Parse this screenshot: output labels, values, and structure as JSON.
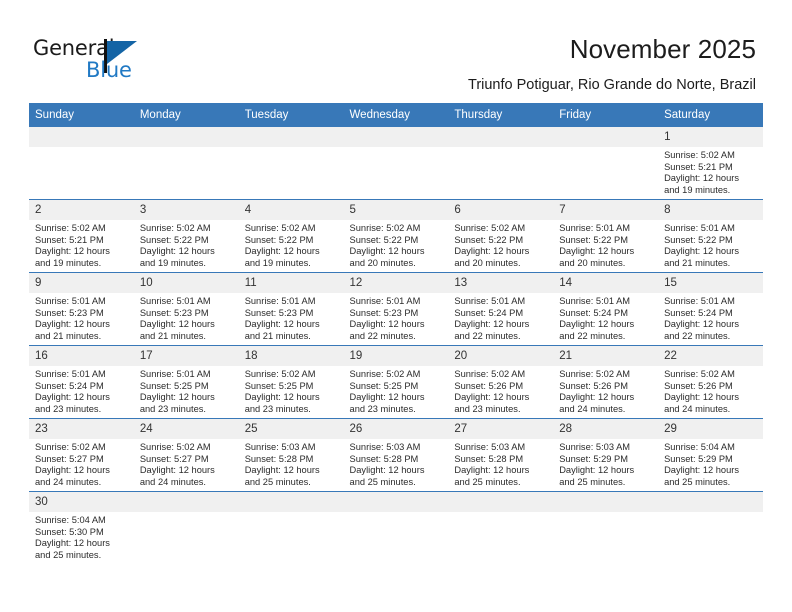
{
  "brand": {
    "name_part1": "General",
    "name_part2": "Blue",
    "flag_icon": "triangle-flag-icon",
    "colors": {
      "brand_blue": "#2079c4",
      "flag_blue": "#1464a5",
      "header_blue": "#3878b8",
      "date_band_gray": "#f0f0f0"
    }
  },
  "header": {
    "title": "November 2025",
    "subtitle": "Triunfo Potiguar, Rio Grande do Norte, Brazil"
  },
  "calendar": {
    "weekday_headers": [
      "Sunday",
      "Monday",
      "Tuesday",
      "Wednesday",
      "Thursday",
      "Friday",
      "Saturday"
    ],
    "weeks": [
      [
        {
          "day": "",
          "blank": true
        },
        {
          "day": "",
          "blank": true
        },
        {
          "day": "",
          "blank": true
        },
        {
          "day": "",
          "blank": true
        },
        {
          "day": "",
          "blank": true
        },
        {
          "day": "",
          "blank": true
        },
        {
          "day": "1",
          "sunrise": "Sunrise: 5:02 AM",
          "sunset": "Sunset: 5:21 PM",
          "daylight_line1": "Daylight: 12 hours",
          "daylight_line2": "and 19 minutes."
        }
      ],
      [
        {
          "day": "2",
          "sunrise": "Sunrise: 5:02 AM",
          "sunset": "Sunset: 5:21 PM",
          "daylight_line1": "Daylight: 12 hours",
          "daylight_line2": "and 19 minutes."
        },
        {
          "day": "3",
          "sunrise": "Sunrise: 5:02 AM",
          "sunset": "Sunset: 5:22 PM",
          "daylight_line1": "Daylight: 12 hours",
          "daylight_line2": "and 19 minutes."
        },
        {
          "day": "4",
          "sunrise": "Sunrise: 5:02 AM",
          "sunset": "Sunset: 5:22 PM",
          "daylight_line1": "Daylight: 12 hours",
          "daylight_line2": "and 19 minutes."
        },
        {
          "day": "5",
          "sunrise": "Sunrise: 5:02 AM",
          "sunset": "Sunset: 5:22 PM",
          "daylight_line1": "Daylight: 12 hours",
          "daylight_line2": "and 20 minutes."
        },
        {
          "day": "6",
          "sunrise": "Sunrise: 5:02 AM",
          "sunset": "Sunset: 5:22 PM",
          "daylight_line1": "Daylight: 12 hours",
          "daylight_line2": "and 20 minutes."
        },
        {
          "day": "7",
          "sunrise": "Sunrise: 5:01 AM",
          "sunset": "Sunset: 5:22 PM",
          "daylight_line1": "Daylight: 12 hours",
          "daylight_line2": "and 20 minutes."
        },
        {
          "day": "8",
          "sunrise": "Sunrise: 5:01 AM",
          "sunset": "Sunset: 5:22 PM",
          "daylight_line1": "Daylight: 12 hours",
          "daylight_line2": "and 21 minutes."
        }
      ],
      [
        {
          "day": "9",
          "sunrise": "Sunrise: 5:01 AM",
          "sunset": "Sunset: 5:23 PM",
          "daylight_line1": "Daylight: 12 hours",
          "daylight_line2": "and 21 minutes."
        },
        {
          "day": "10",
          "sunrise": "Sunrise: 5:01 AM",
          "sunset": "Sunset: 5:23 PM",
          "daylight_line1": "Daylight: 12 hours",
          "daylight_line2": "and 21 minutes."
        },
        {
          "day": "11",
          "sunrise": "Sunrise: 5:01 AM",
          "sunset": "Sunset: 5:23 PM",
          "daylight_line1": "Daylight: 12 hours",
          "daylight_line2": "and 21 minutes."
        },
        {
          "day": "12",
          "sunrise": "Sunrise: 5:01 AM",
          "sunset": "Sunset: 5:23 PM",
          "daylight_line1": "Daylight: 12 hours",
          "daylight_line2": "and 22 minutes."
        },
        {
          "day": "13",
          "sunrise": "Sunrise: 5:01 AM",
          "sunset": "Sunset: 5:24 PM",
          "daylight_line1": "Daylight: 12 hours",
          "daylight_line2": "and 22 minutes."
        },
        {
          "day": "14",
          "sunrise": "Sunrise: 5:01 AM",
          "sunset": "Sunset: 5:24 PM",
          "daylight_line1": "Daylight: 12 hours",
          "daylight_line2": "and 22 minutes."
        },
        {
          "day": "15",
          "sunrise": "Sunrise: 5:01 AM",
          "sunset": "Sunset: 5:24 PM",
          "daylight_line1": "Daylight: 12 hours",
          "daylight_line2": "and 22 minutes."
        }
      ],
      [
        {
          "day": "16",
          "sunrise": "Sunrise: 5:01 AM",
          "sunset": "Sunset: 5:24 PM",
          "daylight_line1": "Daylight: 12 hours",
          "daylight_line2": "and 23 minutes."
        },
        {
          "day": "17",
          "sunrise": "Sunrise: 5:01 AM",
          "sunset": "Sunset: 5:25 PM",
          "daylight_line1": "Daylight: 12 hours",
          "daylight_line2": "and 23 minutes."
        },
        {
          "day": "18",
          "sunrise": "Sunrise: 5:02 AM",
          "sunset": "Sunset: 5:25 PM",
          "daylight_line1": "Daylight: 12 hours",
          "daylight_line2": "and 23 minutes."
        },
        {
          "day": "19",
          "sunrise": "Sunrise: 5:02 AM",
          "sunset": "Sunset: 5:25 PM",
          "daylight_line1": "Daylight: 12 hours",
          "daylight_line2": "and 23 minutes."
        },
        {
          "day": "20",
          "sunrise": "Sunrise: 5:02 AM",
          "sunset": "Sunset: 5:26 PM",
          "daylight_line1": "Daylight: 12 hours",
          "daylight_line2": "and 23 minutes."
        },
        {
          "day": "21",
          "sunrise": "Sunrise: 5:02 AM",
          "sunset": "Sunset: 5:26 PM",
          "daylight_line1": "Daylight: 12 hours",
          "daylight_line2": "and 24 minutes."
        },
        {
          "day": "22",
          "sunrise": "Sunrise: 5:02 AM",
          "sunset": "Sunset: 5:26 PM",
          "daylight_line1": "Daylight: 12 hours",
          "daylight_line2": "and 24 minutes."
        }
      ],
      [
        {
          "day": "23",
          "sunrise": "Sunrise: 5:02 AM",
          "sunset": "Sunset: 5:27 PM",
          "daylight_line1": "Daylight: 12 hours",
          "daylight_line2": "and 24 minutes."
        },
        {
          "day": "24",
          "sunrise": "Sunrise: 5:02 AM",
          "sunset": "Sunset: 5:27 PM",
          "daylight_line1": "Daylight: 12 hours",
          "daylight_line2": "and 24 minutes."
        },
        {
          "day": "25",
          "sunrise": "Sunrise: 5:03 AM",
          "sunset": "Sunset: 5:28 PM",
          "daylight_line1": "Daylight: 12 hours",
          "daylight_line2": "and 25 minutes."
        },
        {
          "day": "26",
          "sunrise": "Sunrise: 5:03 AM",
          "sunset": "Sunset: 5:28 PM",
          "daylight_line1": "Daylight: 12 hours",
          "daylight_line2": "and 25 minutes."
        },
        {
          "day": "27",
          "sunrise": "Sunrise: 5:03 AM",
          "sunset": "Sunset: 5:28 PM",
          "daylight_line1": "Daylight: 12 hours",
          "daylight_line2": "and 25 minutes."
        },
        {
          "day": "28",
          "sunrise": "Sunrise: 5:03 AM",
          "sunset": "Sunset: 5:29 PM",
          "daylight_line1": "Daylight: 12 hours",
          "daylight_line2": "and 25 minutes."
        },
        {
          "day": "29",
          "sunrise": "Sunrise: 5:04 AM",
          "sunset": "Sunset: 5:29 PM",
          "daylight_line1": "Daylight: 12 hours",
          "daylight_line2": "and 25 minutes."
        }
      ],
      [
        {
          "day": "30",
          "sunrise": "Sunrise: 5:04 AM",
          "sunset": "Sunset: 5:30 PM",
          "daylight_line1": "Daylight: 12 hours",
          "daylight_line2": "and 25 minutes."
        },
        {
          "day": "",
          "blank": true
        },
        {
          "day": "",
          "blank": true
        },
        {
          "day": "",
          "blank": true
        },
        {
          "day": "",
          "blank": true
        },
        {
          "day": "",
          "blank": true
        },
        {
          "day": "",
          "blank": true
        }
      ]
    ]
  }
}
